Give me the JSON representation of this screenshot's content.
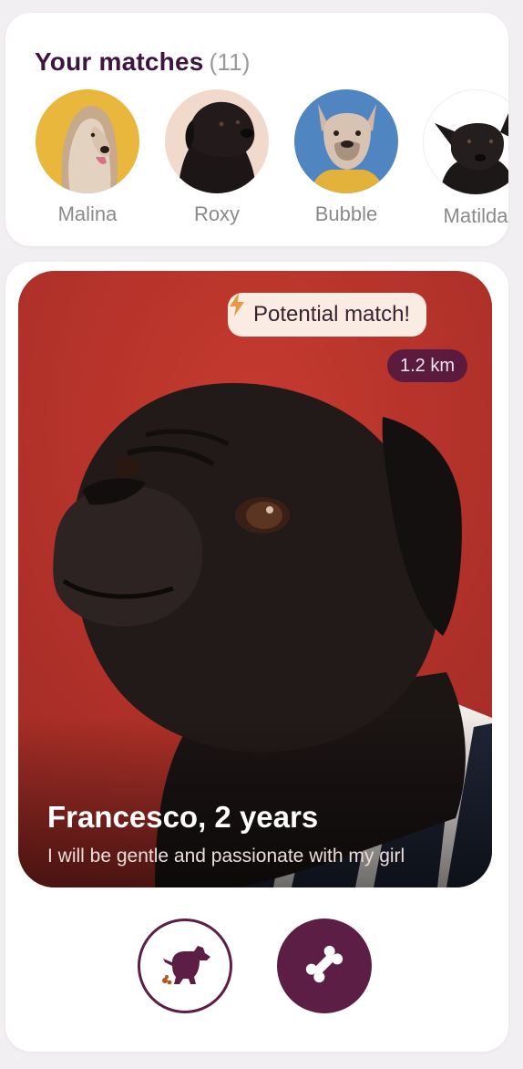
{
  "matches": {
    "title": "Your matches",
    "count": "(11)",
    "items": [
      {
        "name": "Malina",
        "avatar_bg": "#e8b73c",
        "icon": "afghan-hound-avatar"
      },
      {
        "name": "Roxy",
        "avatar_bg": "#f1d9cc",
        "icon": "black-labrador-avatar"
      },
      {
        "name": "Bubble",
        "avatar_bg": "#4f86c1",
        "icon": "french-bulldog-avatar"
      },
      {
        "name": "Matilda",
        "avatar_bg": "#ffffff",
        "icon": "black-shepherd-avatar"
      }
    ]
  },
  "profile": {
    "badge": "Potential match!",
    "distance": "1.2 km",
    "name": "Francesco, 2 years",
    "bio": "I will be gentle and passionate with my girl",
    "photo_bg": "#c0322a"
  },
  "actions": {
    "pass_icon": "dog-poop-icon",
    "like_icon": "bone-icon"
  },
  "colors": {
    "brand": "#5c1e45",
    "title": "#3e1440",
    "badge_bg": "#fbece3",
    "lightning": "#e79a45"
  }
}
